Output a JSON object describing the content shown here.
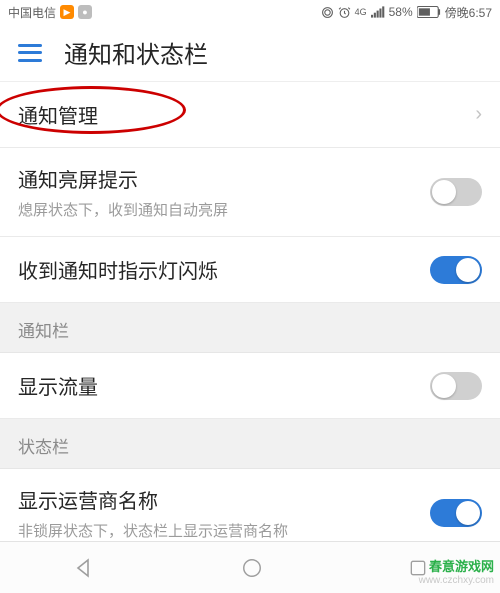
{
  "statusbar": {
    "carrier": "中国电信",
    "network_label": "4G",
    "battery_pct": "58%",
    "time": "傍晚6:57"
  },
  "header": {
    "title": "通知和状态栏"
  },
  "rows": {
    "notif_mgmt": {
      "title": "通知管理"
    },
    "wake_on_notif": {
      "title": "通知亮屏提示",
      "sub": "熄屏状态下，收到通知自动亮屏"
    },
    "led_blink": {
      "title": "收到通知时指示灯闪烁"
    },
    "show_traffic": {
      "title": "显示流量"
    },
    "show_carrier": {
      "title": "显示运营商名称",
      "sub": "非锁屏状态下，状态栏上显示运营商名称"
    }
  },
  "sections": {
    "notif_panel": "通知栏",
    "status_bar": "状态栏"
  },
  "watermark": {
    "brand": "春意游戏网",
    "url": "www.czchxy.com"
  }
}
